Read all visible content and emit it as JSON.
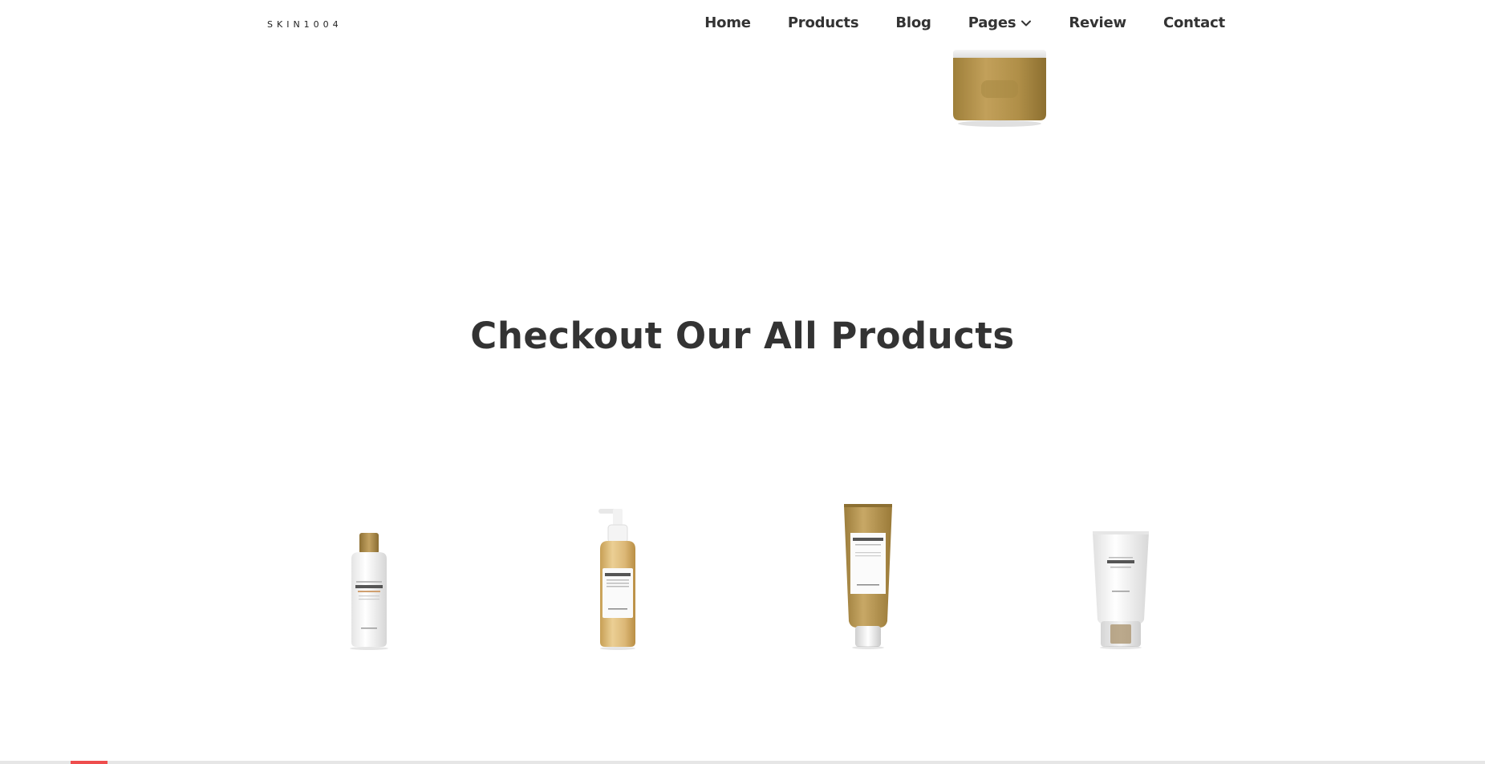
{
  "header": {
    "logo": "SKIN1004",
    "nav": [
      {
        "label": "Home"
      },
      {
        "label": "Products"
      },
      {
        "label": "Blog"
      },
      {
        "label": "Pages",
        "has_dropdown": true
      },
      {
        "label": "Review"
      },
      {
        "label": "Contact"
      }
    ]
  },
  "main": {
    "section_title": "Checkout Our All Products"
  },
  "products": [
    {
      "icon": "sunscreen-bottle-icon"
    },
    {
      "icon": "cleansing-oil-pump-icon"
    },
    {
      "icon": "gold-tube-icon"
    },
    {
      "icon": "white-tube-icon"
    }
  ],
  "colors": {
    "gold": "#b8964a",
    "text": "#333333",
    "accent": "#ee4d4d"
  }
}
